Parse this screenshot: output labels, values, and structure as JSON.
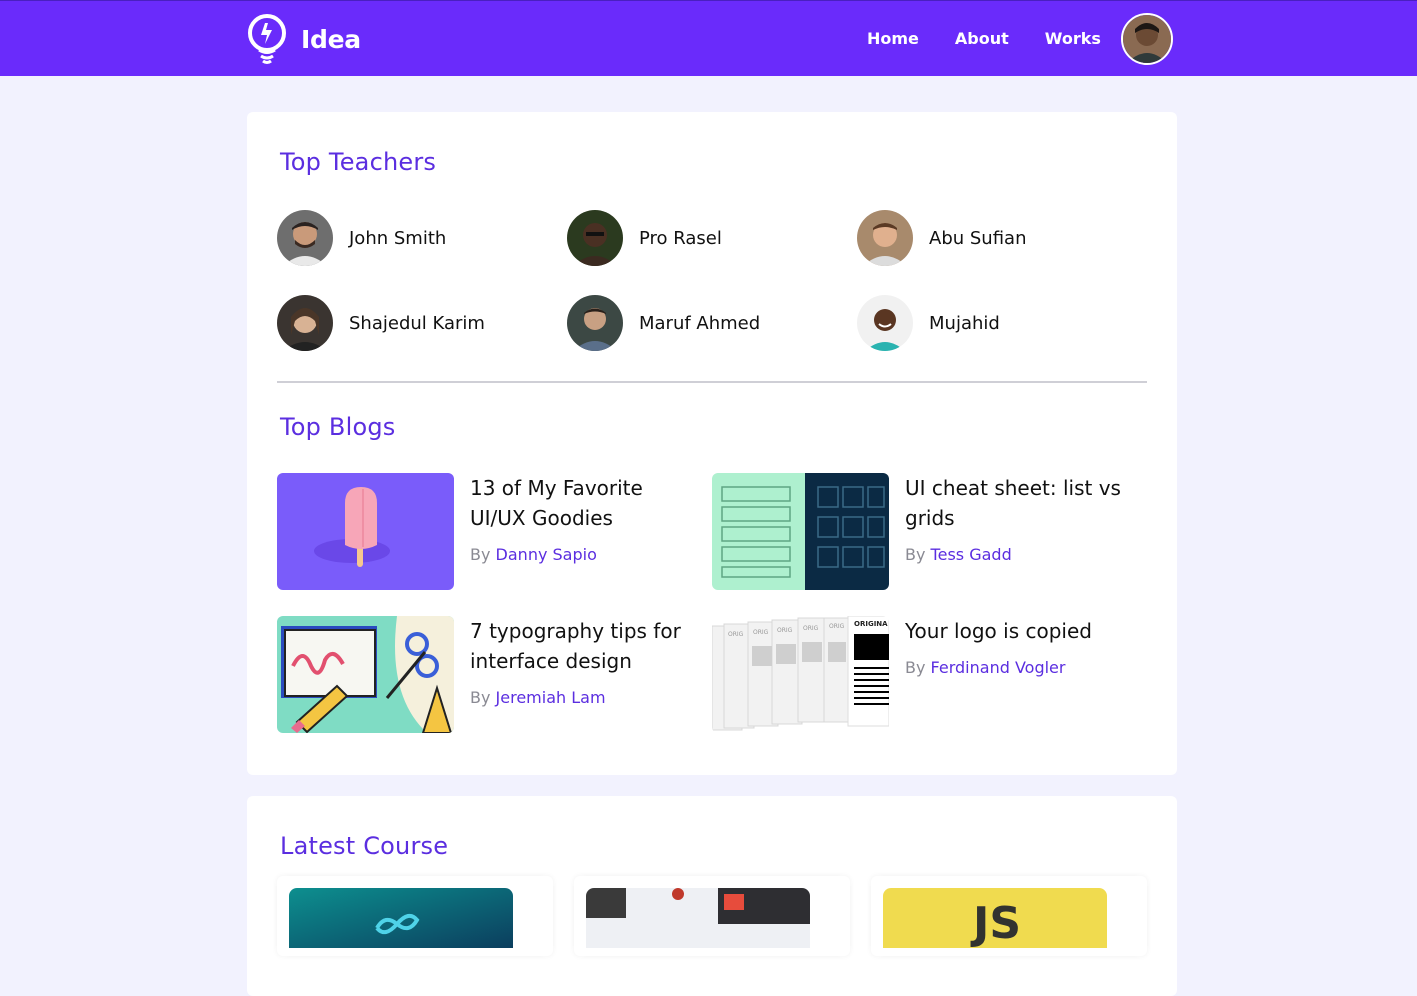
{
  "brand": {
    "name": "Idea"
  },
  "nav": {
    "links": [
      "Home",
      "About",
      "Works"
    ]
  },
  "colors": {
    "primary": "#6A2BFB",
    "accent": "#5B2EE0",
    "background": "#F2F2FE"
  },
  "teachers": {
    "title": "Top Teachers",
    "items": [
      {
        "name": "John Smith"
      },
      {
        "name": "Pro Rasel"
      },
      {
        "name": "Abu Sufian"
      },
      {
        "name": "Shajedul Karim"
      },
      {
        "name": "Maruf Ahmed"
      },
      {
        "name": "Mujahid"
      }
    ]
  },
  "blogs": {
    "title": "Top Blogs",
    "by_label": "By",
    "items": [
      {
        "title": "13 of My Favorite UI/UX Goodies",
        "author": "Danny Sapio"
      },
      {
        "title": "UI cheat sheet: list vs grids",
        "author": "Tess Gadd"
      },
      {
        "title": "7 typography tips for interface design",
        "author": "Jeremiah Lam"
      },
      {
        "title": "Your logo is copied",
        "author": "Ferdinand Vogler"
      }
    ]
  },
  "courses": {
    "title": "Latest Course",
    "thumb_texts": {
      "js_logo": "JS",
      "original_label": "ORIGINA",
      "original_partial": "ORIG"
    }
  }
}
